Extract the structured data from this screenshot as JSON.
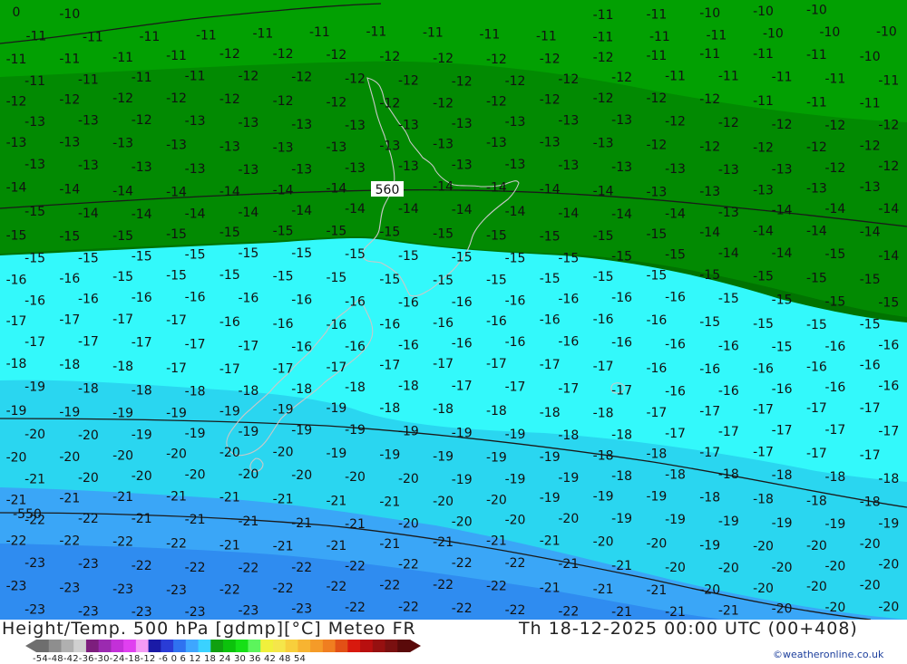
{
  "map": {
    "contour_label": "560",
    "contour_label_2": "-550",
    "isotherm_label_rows": [
      [
        "0",
        "-10",
        "",
        "",
        "",
        "",
        "",
        "",
        "",
        "",
        "",
        "-11",
        "-11",
        "-10",
        "-10",
        "-10",
        ""
      ],
      [
        "-11",
        "-11",
        "-11",
        "-11",
        "-11",
        "-11",
        "-11",
        "-11",
        "-11",
        "-11",
        "-11",
        "-11",
        "-11",
        "-10",
        "-10",
        "-10"
      ],
      [
        "-11",
        "-11",
        "-11",
        "-11",
        "-12",
        "-12",
        "-12",
        "-12",
        "-12",
        "-12",
        "-12",
        "-12",
        "-11",
        "-11",
        "-11",
        "-11",
        "-10"
      ],
      [
        "-11",
        "-11",
        "-11",
        "-11",
        "-12",
        "-12",
        "-12",
        "-12",
        "-12",
        "-12",
        "-12",
        "-12",
        "-11",
        "-11",
        "-11",
        "-11",
        "-11"
      ],
      [
        "-12",
        "-12",
        "-12",
        "-12",
        "-12",
        "-12",
        "-12",
        "-12",
        "-12",
        "-12",
        "-12",
        "-12",
        "-12",
        "-12",
        "-11",
        "-11",
        "-11"
      ],
      [
        "-13",
        "-13",
        "-12",
        "-13",
        "-13",
        "-13",
        "-13",
        "-13",
        "-13",
        "-13",
        "-13",
        "-13",
        "-12",
        "-12",
        "-12",
        "-12",
        "-12"
      ],
      [
        "-13",
        "-13",
        "-13",
        "-13",
        "-13",
        "-13",
        "-13",
        "-13",
        "-13",
        "-13",
        "-13",
        "-13",
        "-12",
        "-12",
        "-12",
        "-12",
        "-12"
      ],
      [
        "-13",
        "-13",
        "-13",
        "-13",
        "-13",
        "-13",
        "-13",
        "-13",
        "-13",
        "-13",
        "-13",
        "-13",
        "-13",
        "-13",
        "-13",
        "-12",
        "-12"
      ],
      [
        "-14",
        "-14",
        "-14",
        "-14",
        "-14",
        "-14",
        "-14",
        "-14",
        "-14",
        "-14",
        "-14",
        "-14",
        "-13",
        "-13",
        "-13",
        "-13",
        "-13"
      ],
      [
        "-15",
        "-14",
        "-14",
        "-14",
        "-14",
        "-14",
        "-14",
        "-14",
        "-14",
        "-14",
        "-14",
        "-14",
        "-14",
        "-13",
        "-14",
        "-14",
        "-14"
      ],
      [
        "-15",
        "-15",
        "-15",
        "-15",
        "-15",
        "-15",
        "-15",
        "-15",
        "-15",
        "-15",
        "-15",
        "-15",
        "-15",
        "-14",
        "-14",
        "-14",
        "-14"
      ],
      [
        "-15",
        "-15",
        "-15",
        "-15",
        "-15",
        "-15",
        "-15",
        "-15",
        "-15",
        "-15",
        "-15",
        "-15",
        "-15",
        "-14",
        "-14",
        "-15",
        "-14"
      ],
      [
        "-16",
        "-16",
        "-15",
        "-15",
        "-15",
        "-15",
        "-15",
        "-15",
        "-15",
        "-15",
        "-15",
        "-15",
        "-15",
        "-15",
        "-15",
        "-15",
        "-15"
      ],
      [
        "-16",
        "-16",
        "-16",
        "-16",
        "-16",
        "-16",
        "-16",
        "-16",
        "-16",
        "-16",
        "-16",
        "-16",
        "-16",
        "-15",
        "-15",
        "-15",
        "-15"
      ],
      [
        "-17",
        "-17",
        "-17",
        "-17",
        "-16",
        "-16",
        "-16",
        "-16",
        "-16",
        "-16",
        "-16",
        "-16",
        "-16",
        "-15",
        "-15",
        "-15",
        "-15"
      ],
      [
        "-17",
        "-17",
        "-17",
        "-17",
        "-17",
        "-16",
        "-16",
        "-16",
        "-16",
        "-16",
        "-16",
        "-16",
        "-16",
        "-16",
        "-15",
        "-16",
        "-16"
      ],
      [
        "-18",
        "-18",
        "-18",
        "-17",
        "-17",
        "-17",
        "-17",
        "-17",
        "-17",
        "-17",
        "-17",
        "-17",
        "-16",
        "-16",
        "-16",
        "-16",
        "-16"
      ],
      [
        "-19",
        "-18",
        "-18",
        "-18",
        "-18",
        "-18",
        "-18",
        "-18",
        "-17",
        "-17",
        "-17",
        "-17",
        "-16",
        "-16",
        "-16",
        "-16",
        "-16"
      ],
      [
        "-19",
        "-19",
        "-19",
        "-19",
        "-19",
        "-19",
        "-19",
        "-18",
        "-18",
        "-18",
        "-18",
        "-18",
        "-17",
        "-17",
        "-17",
        "-17",
        "-17"
      ],
      [
        "-20",
        "-20",
        "-19",
        "-19",
        "-19",
        "-19",
        "-19",
        "-19",
        "-19",
        "-19",
        "-18",
        "-18",
        "-17",
        "-17",
        "-17",
        "-17",
        "-17"
      ],
      [
        "-20",
        "-20",
        "-20",
        "-20",
        "-20",
        "-20",
        "-19",
        "-19",
        "-19",
        "-19",
        "-19",
        "-18",
        "-18",
        "-17",
        "-17",
        "-17",
        "-17"
      ],
      [
        "-21",
        "-20",
        "-20",
        "-20",
        "-20",
        "-20",
        "-20",
        "-20",
        "-19",
        "-19",
        "-19",
        "-18",
        "-18",
        "-18",
        "-18",
        "-18",
        "-18"
      ],
      [
        "-21",
        "-21",
        "-21",
        "-21",
        "-21",
        "-21",
        "-21",
        "-21",
        "-20",
        "-20",
        "-19",
        "-19",
        "-19",
        "-18",
        "-18",
        "-18",
        "-18"
      ],
      [
        "-22",
        "-22",
        "-21",
        "-21",
        "-21",
        "-21",
        "-21",
        "-20",
        "-20",
        "-20",
        "-20",
        "-19",
        "-19",
        "-19",
        "-19",
        "-19",
        "-19"
      ],
      [
        "-22",
        "-22",
        "-22",
        "-22",
        "-21",
        "-21",
        "-21",
        "-21",
        "-21",
        "-21",
        "-21",
        "-20",
        "-20",
        "-19",
        "-20",
        "-20",
        "-20"
      ],
      [
        "-23",
        "-23",
        "-22",
        "-22",
        "-22",
        "-22",
        "-22",
        "-22",
        "-22",
        "-22",
        "-21",
        "-21",
        "-20",
        "-20",
        "-20",
        "-20",
        "-20"
      ],
      [
        "-23",
        "-23",
        "-23",
        "-23",
        "-22",
        "-22",
        "-22",
        "-22",
        "-22",
        "-22",
        "-21",
        "-21",
        "-21",
        "-20",
        "-20",
        "-20",
        "-20"
      ],
      [
        "-23",
        "-23",
        "-23",
        "-23",
        "-23",
        "-23",
        "-22",
        "-22",
        "-22",
        "-22",
        "-22",
        "-21",
        "-21",
        "-21",
        "-20",
        "-20",
        "-20"
      ]
    ]
  },
  "footer": {
    "title": "Height/Temp. 500 hPa [gdmp][°C] Meteo FR",
    "valid_time": "Th 18-12-2025 00:00 UTC (00+408)",
    "credit": "©weatheronline.co.uk",
    "scale_ticks": "-54-48-42-36-30-24-18-12 -6  0  6  12  18  24  30  36  42  48  54",
    "scale_colors": [
      "#6e6e6e",
      "#8e8e8e",
      "#b0b0b0",
      "#d0d0d0",
      "#7d1e7d",
      "#9b2ab0",
      "#c330d8",
      "#e040f0",
      "#f59bf5",
      "#1a1aa6",
      "#2a3cd6",
      "#2f72f0",
      "#3ea6ff",
      "#3ad2ff",
      "#10a010",
      "#0cc20c",
      "#16e016",
      "#5cf55c",
      "#f0f03c",
      "#f5e64a",
      "#f8cf3c",
      "#f7b431",
      "#f59b28",
      "#f07e20",
      "#e25016",
      "#d8190e",
      "#b80f0f",
      "#961010",
      "#7a1010",
      "#5a0a0a"
    ]
  }
}
